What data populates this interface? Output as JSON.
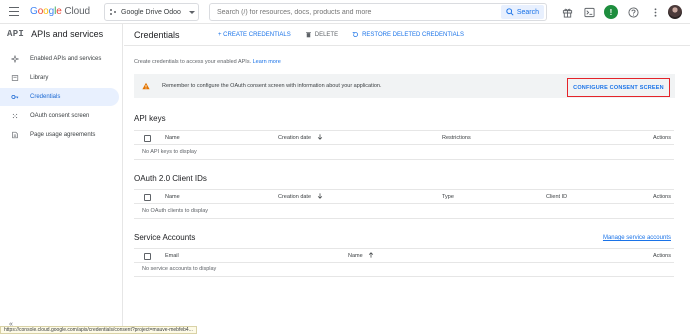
{
  "topbar": {
    "logo_google": [
      "G",
      "o",
      "o",
      "g",
      "l",
      "e"
    ],
    "logo_cloud": "Cloud",
    "project_name": "Google Drive Odoo",
    "search_placeholder": "Search (/) for resources, docs, products and more",
    "search_button": "Search",
    "notification_count": "!"
  },
  "sidebar": {
    "mark": "API",
    "title": "APIs and services",
    "items": [
      {
        "label": "Enabled APIs and services",
        "icon": "enabled-apis-icon"
      },
      {
        "label": "Library",
        "icon": "library-icon"
      },
      {
        "label": "Credentials",
        "icon": "key-icon",
        "active": true
      },
      {
        "label": "OAuth consent screen",
        "icon": "consent-icon"
      },
      {
        "label": "Page usage agreements",
        "icon": "agreements-icon"
      }
    ],
    "collapse": "«"
  },
  "main": {
    "title": "Credentials",
    "actions": {
      "create": "+ CREATE CREDENTIALS",
      "delete": "DELETE",
      "restore": "RESTORE DELETED CREDENTIALS"
    },
    "intro": "Create credentials to access your enabled APIs.",
    "intro_link": "Learn more",
    "warning": "Remember to configure the OAuth consent screen with information about your application.",
    "consent_button": "CONFIGURE CONSENT SCREEN",
    "api_keys": {
      "title": "API keys",
      "columns": [
        "Name",
        "Creation date",
        "Restrictions",
        "Actions"
      ],
      "empty": "No API keys to display"
    },
    "oauth": {
      "title": "OAuth 2.0 Client IDs",
      "columns": [
        "Name",
        "Creation date",
        "Type",
        "Client ID",
        "Actions"
      ],
      "empty": "No OAuth clients to display"
    },
    "service_accounts": {
      "title": "Service Accounts",
      "manage_link": "Manage service accounts",
      "columns": [
        "Email",
        "Name",
        "Actions"
      ],
      "empty": "No service accounts to display"
    }
  },
  "status_bar": "https://console.cloud.google.com/apis/credentials/consent?project=mauve-mebfeb4..."
}
